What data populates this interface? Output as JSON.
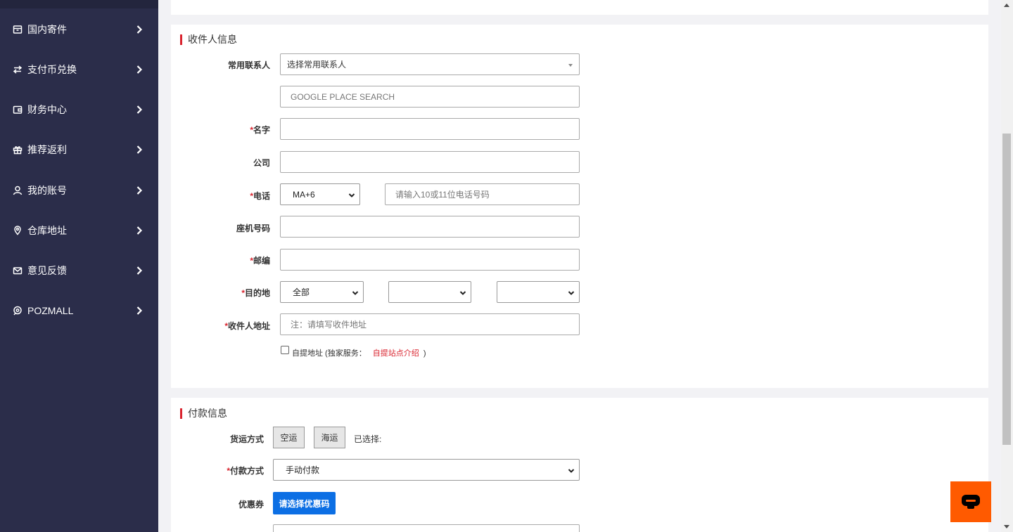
{
  "sidebar": {
    "items": [
      {
        "label": "国内寄件",
        "icon": "package-icon"
      },
      {
        "label": "支付币兑换",
        "icon": "exchange-icon"
      },
      {
        "label": "财务中心",
        "icon": "wallet-icon"
      },
      {
        "label": "推荐返利",
        "icon": "gift-icon"
      },
      {
        "label": "我的账号",
        "icon": "user-icon"
      },
      {
        "label": "仓库地址",
        "icon": "location-pin-icon"
      },
      {
        "label": "意见反馈",
        "icon": "mail-icon"
      },
      {
        "label": "POZMALL",
        "icon": "pozmall-icon"
      }
    ]
  },
  "recipient": {
    "title": "收件人信息",
    "contact_label": "常用联系人",
    "contact_value": "选择常用联系人",
    "place_search_placeholder": "GOOGLE PLACE SEARCH",
    "required_mark": "*",
    "name_label": "名字",
    "company_label": "公司",
    "phone_label": "电话",
    "phone_code": "MA+6",
    "phone_placeholder": "请输入10或11位电话号码",
    "landline_label": "座机号码",
    "zip_label": "邮编",
    "destination_label": "目的地",
    "destination_value": "全部",
    "address_label": "收件人地址",
    "address_placeholder": "注：请填写收件地址",
    "pickup_text": "自提地址 (独家服务：",
    "pickup_link": "自提站点介绍",
    "pickup_close": ")"
  },
  "payment": {
    "title": "付款信息",
    "shipping_label": "货运方式",
    "air_label": "空运",
    "sea_label": "海运",
    "selected_label": "已选择:",
    "method_label": "付款方式",
    "method_value": "手动付款",
    "coupon_label": "优惠券",
    "coupon_button": "请选择优惠码"
  },
  "colors": {
    "sidebar_bg": "#2b2d4a",
    "accent_red": "#d9232e",
    "button_blue": "#0c6fe4",
    "chat_orange": "#ff5a00"
  }
}
